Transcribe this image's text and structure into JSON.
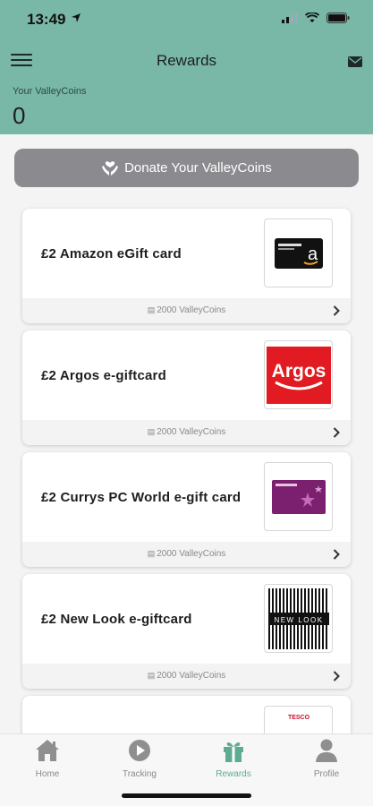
{
  "status": {
    "time": "13:49"
  },
  "header": {
    "title": "Rewards"
  },
  "coins": {
    "label": "Your ValleyCoins",
    "value": "0"
  },
  "donate": {
    "label": "Donate Your ValleyCoins"
  },
  "cards": [
    {
      "title": "£2 Amazon eGift card",
      "cost": "2000 ValleyCoins",
      "thumb": "amazon"
    },
    {
      "title": "£2 Argos e-giftcard",
      "cost": "2000 ValleyCoins",
      "thumb": "argos"
    },
    {
      "title": "£2 Currys PC World e-gift card",
      "cost": "2000 ValleyCoins",
      "thumb": "currys"
    },
    {
      "title": "£2 New Look e-giftcard",
      "cost": "2000 ValleyCoins",
      "thumb": "newlook"
    }
  ],
  "thumbs": {
    "argos_text": "Argos",
    "newlook_text": "NEW LOOK",
    "peek_text": "TESCO"
  },
  "tabs": [
    {
      "label": "Home",
      "icon": "home-icon"
    },
    {
      "label": "Tracking",
      "icon": "play-circle-icon"
    },
    {
      "label": "Rewards",
      "icon": "gift-icon",
      "active": true
    },
    {
      "label": "Profile",
      "icon": "user-icon"
    }
  ],
  "colors": {
    "header": "#79b8a6",
    "accent": "#5eab93",
    "donate_bg": "#8b8b8f"
  }
}
